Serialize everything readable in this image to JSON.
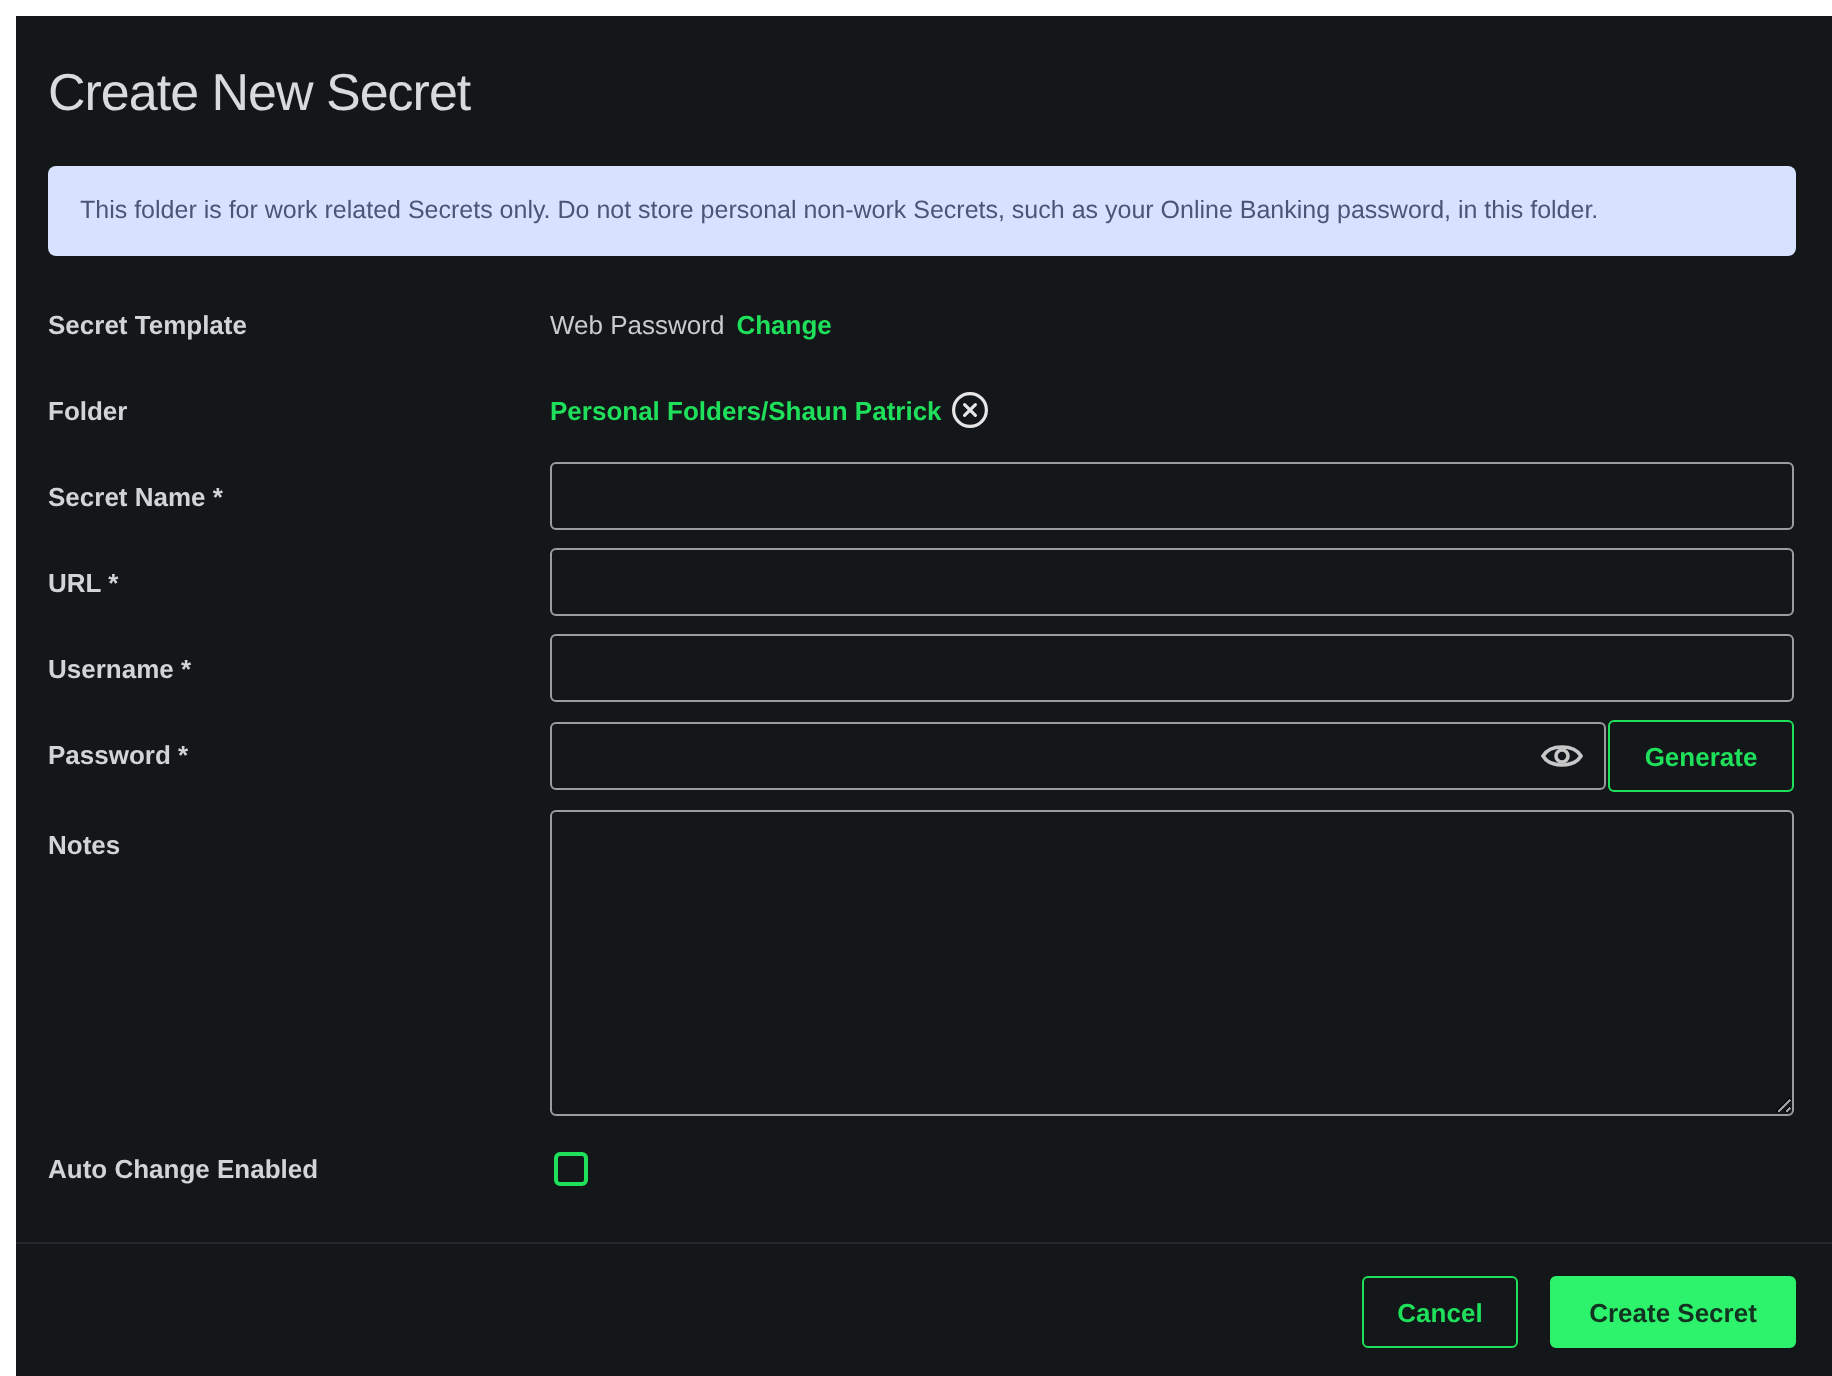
{
  "dialog": {
    "title": "Create New Secret",
    "notice": "This folder is for work related Secrets only. Do not store personal non-work Secrets, such as your Online Banking password, in this folder.",
    "fields": [
      {
        "kind": "template",
        "label": "Secret Template",
        "value": "Web Password",
        "action": "Change"
      },
      {
        "kind": "folder",
        "label": "Folder",
        "value": "Personal Folders/Shaun Patrick"
      },
      {
        "kind": "text",
        "label": "Secret Name *"
      },
      {
        "kind": "text",
        "label": "URL *"
      },
      {
        "kind": "text",
        "label": "Username *"
      },
      {
        "kind": "password",
        "label": "Password *",
        "button": "Generate"
      },
      {
        "kind": "textarea",
        "label": "Notes"
      },
      {
        "kind": "checkbox",
        "label": "Auto Change Enabled",
        "checked": false
      }
    ],
    "buttons": [
      {
        "kind": "secondary",
        "label": "Cancel"
      },
      {
        "kind": "primary",
        "label": "Create Secret"
      }
    ]
  }
}
